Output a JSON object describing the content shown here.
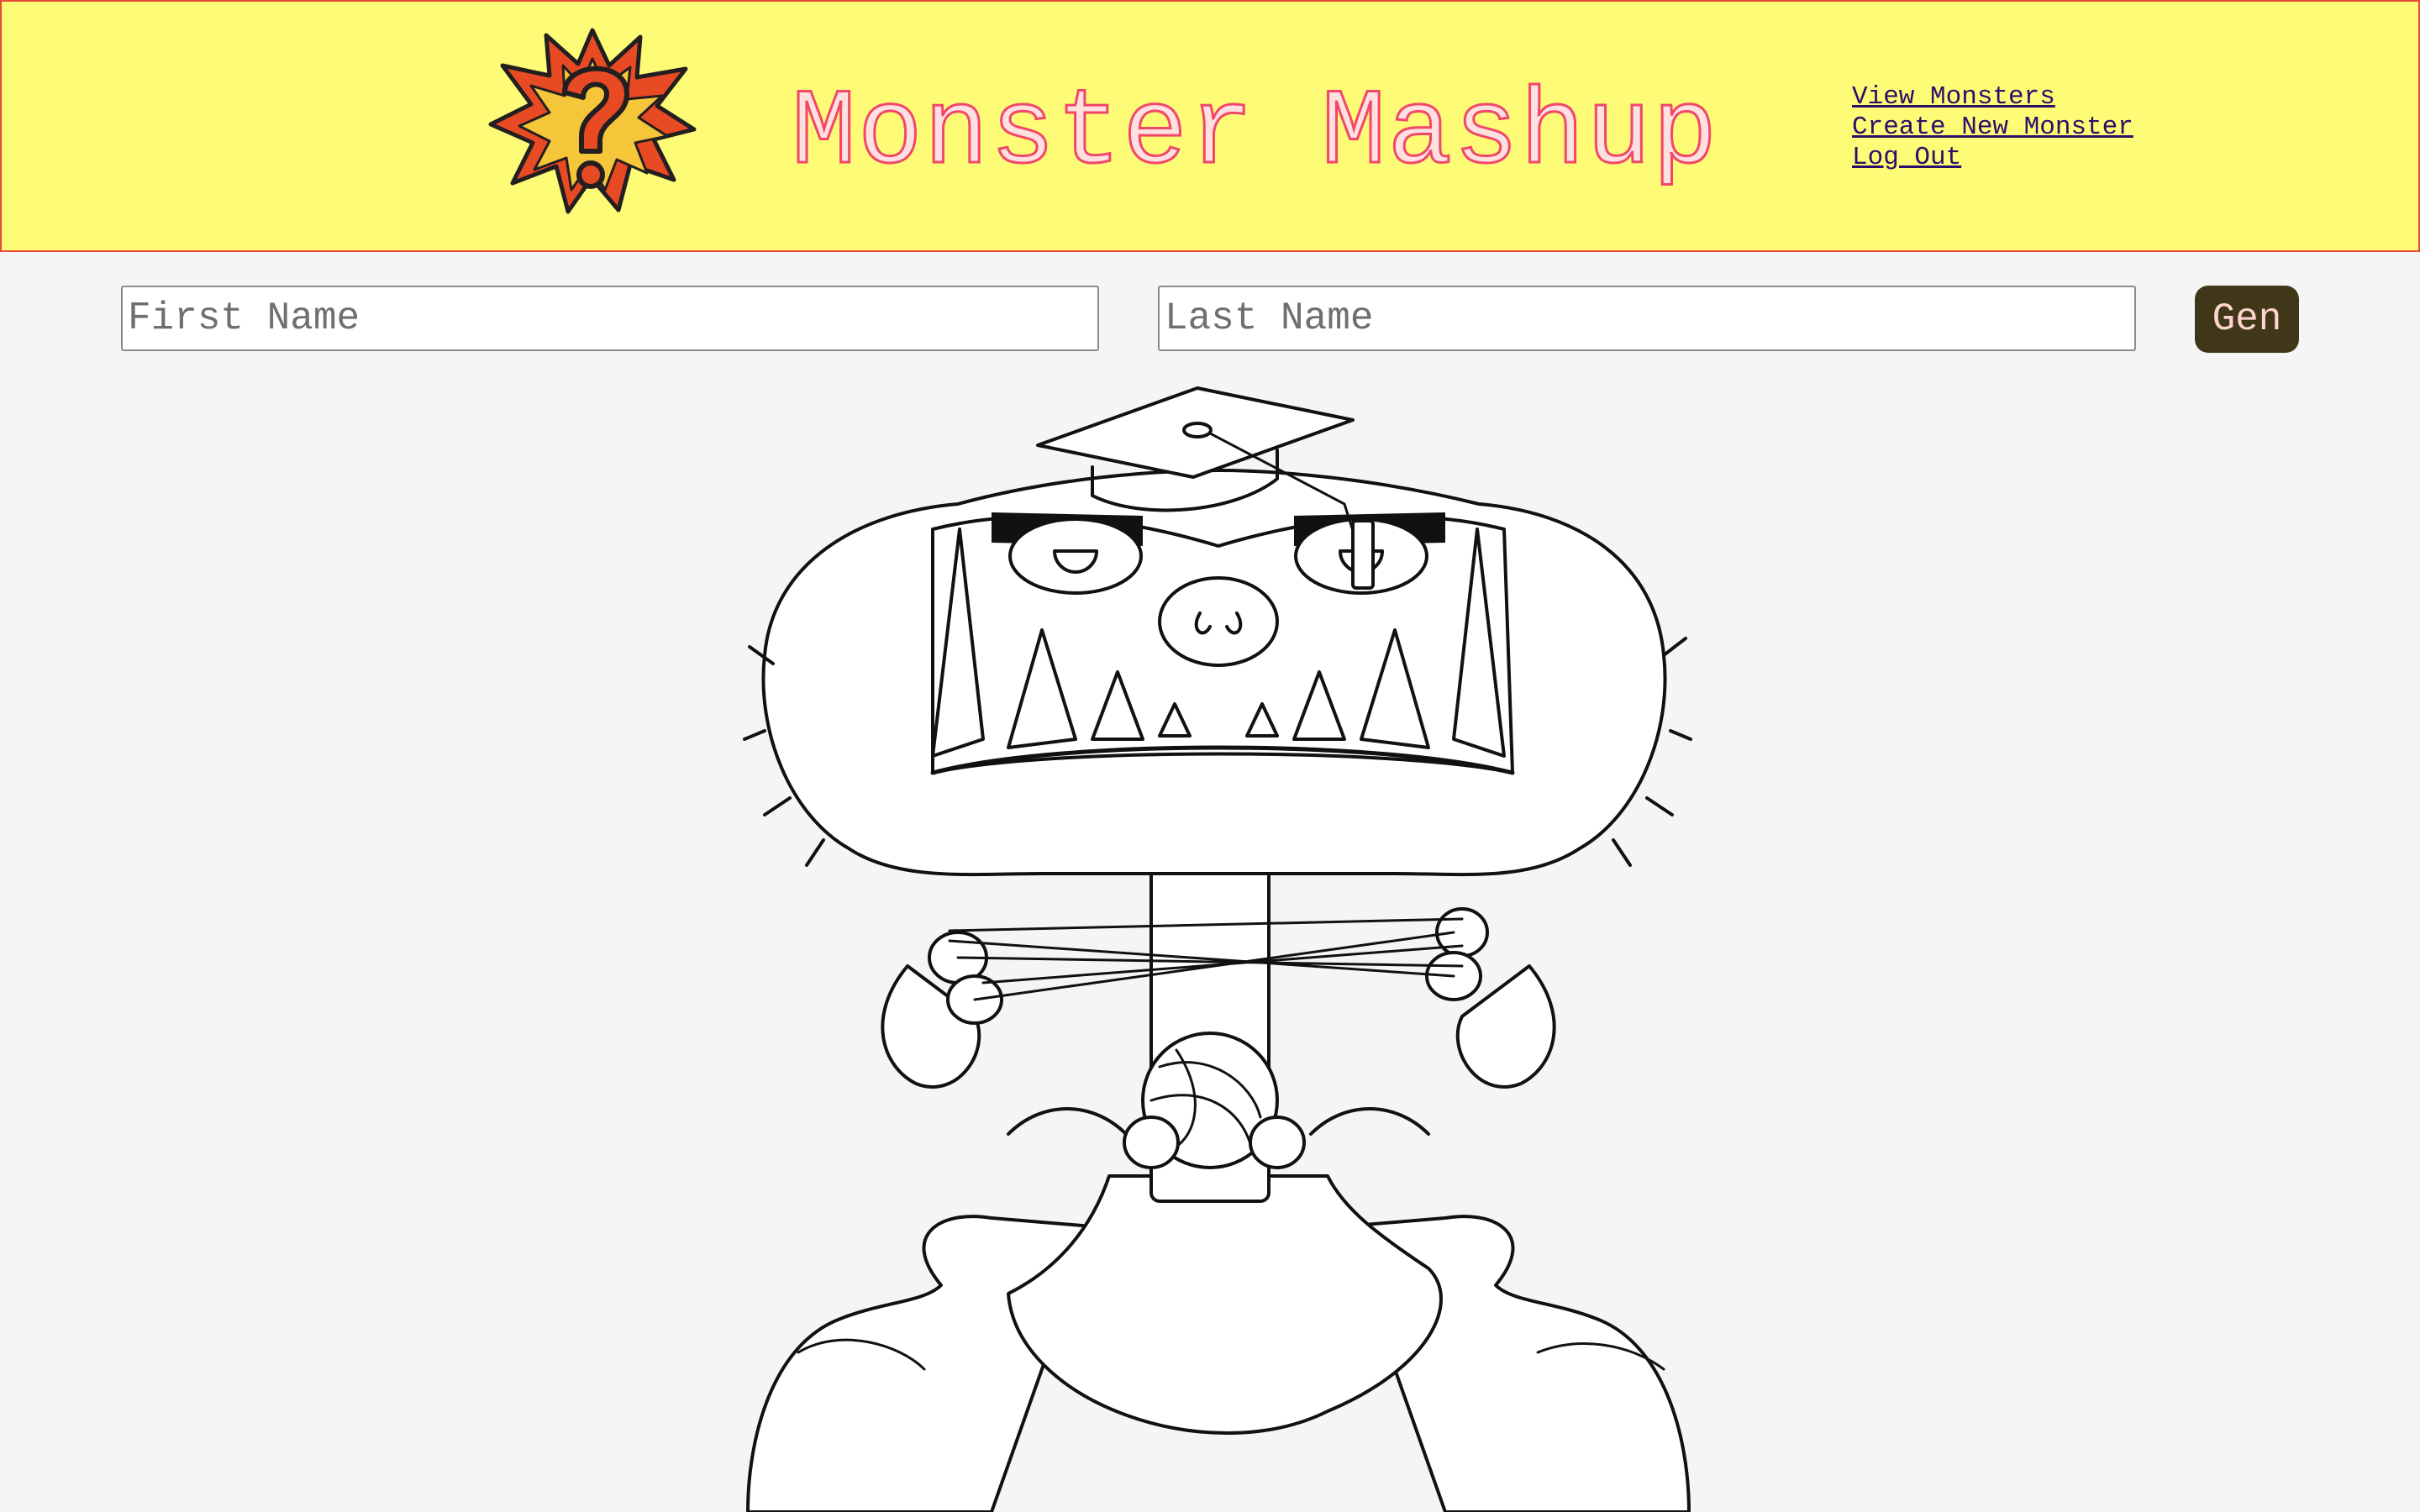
{
  "header": {
    "title": "Monster Mashup",
    "logo_icon": "question-mark-burst-icon",
    "nav": [
      {
        "label": "View Monsters"
      },
      {
        "label": "Create New Monster"
      },
      {
        "label": "Log Out"
      }
    ]
  },
  "form": {
    "first_name_placeholder": "First Name",
    "last_name_placeholder": "Last Name",
    "generate_label": "Gen"
  },
  "monster": {
    "image_icon": "monster-illustration"
  },
  "colors": {
    "header_bg": "#fefc76",
    "header_border": "#e84a3a",
    "title_stroke": "#f2466a",
    "button_bg": "#3f3718",
    "button_text": "#ffd3cf",
    "page_bg": "#f5f5f5"
  }
}
